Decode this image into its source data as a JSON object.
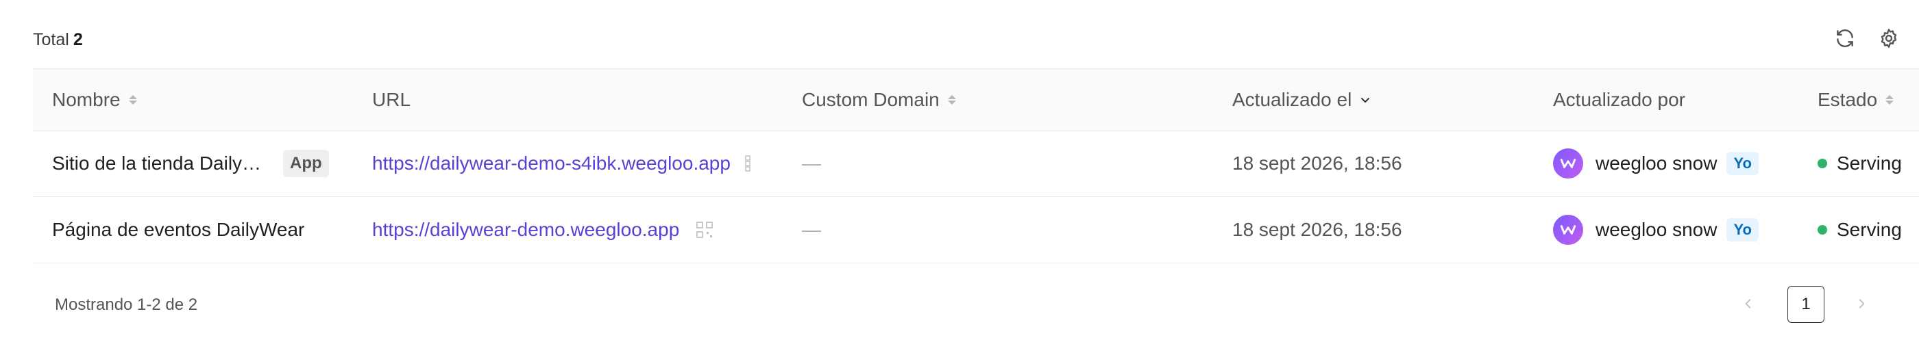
{
  "toolbar": {
    "total_label": "Total",
    "total_count": "2",
    "refresh_icon": "refresh-icon",
    "settings_icon": "gear-icon"
  },
  "table": {
    "columns": {
      "name": "Nombre",
      "url": "URL",
      "custom_domain": "Custom Domain",
      "updated_at": "Actualizado el",
      "updated_by": "Actualizado por",
      "status": "Estado"
    },
    "rows": [
      {
        "name": "Sitio de la tienda Daily…",
        "tag": "App",
        "url": "https://dailywear-demo-s4ibk.weegloo.app",
        "custom_domain": "—",
        "updated_at": "18 sept 2026, 18:56",
        "updated_by": "weegloo snow",
        "me_badge": "Yo",
        "status": "Serving"
      },
      {
        "name": "Página de eventos DailyWear",
        "tag": "",
        "url": "https://dailywear-demo.weegloo.app",
        "custom_domain": "—",
        "updated_at": "18 sept 2026, 18:56",
        "updated_by": "weegloo snow",
        "me_badge": "Yo",
        "status": "Serving"
      }
    ]
  },
  "footer": {
    "showing": "Mostrando 1-2 de 2",
    "current_page": "1"
  },
  "colors": {
    "accent_link": "#5b3fd6",
    "status_serving": "#2fb36b",
    "avatar_gradient_start": "#7b5cff",
    "avatar_gradient_end": "#c05cf0"
  }
}
